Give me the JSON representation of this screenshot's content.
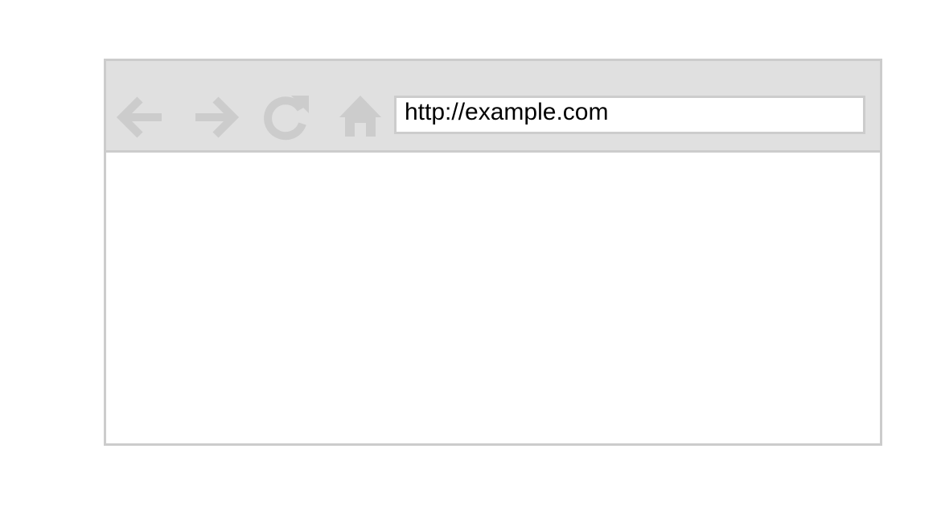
{
  "browser": {
    "address_bar": {
      "url": "http://example.com"
    },
    "toolbar": {
      "buttons": [
        {
          "name": "back",
          "icon": "arrow-left-icon"
        },
        {
          "name": "forward",
          "icon": "arrow-right-icon"
        },
        {
          "name": "reload",
          "icon": "reload-icon"
        },
        {
          "name": "home",
          "icon": "home-icon"
        }
      ]
    }
  },
  "colors": {
    "toolbar_bg": "#e0e0e0",
    "border": "#cccccc",
    "icon": "#cccccc",
    "text": "#000000",
    "page_bg": "#ffffff"
  }
}
